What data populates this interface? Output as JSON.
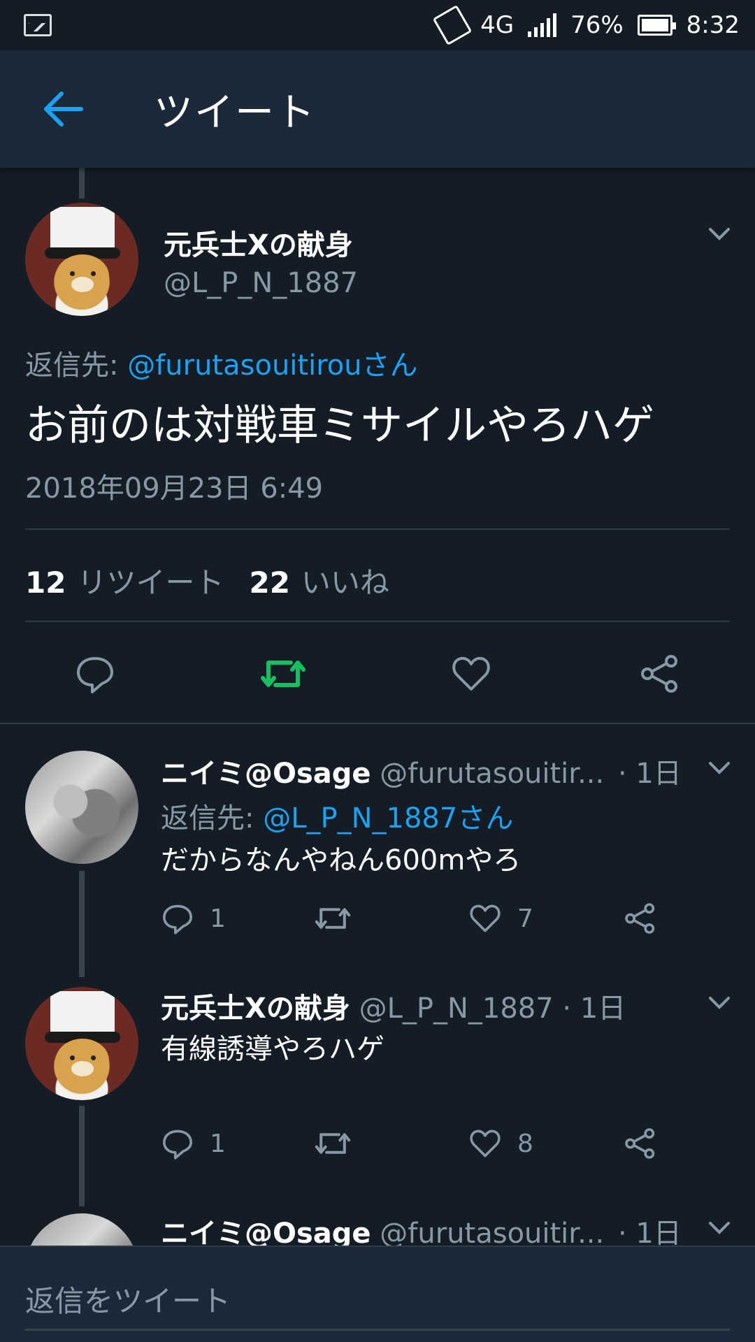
{
  "status_bar": {
    "network": "4G",
    "battery": "76%",
    "time": "8:32",
    "icons": [
      "image-icon",
      "vibrate-icon",
      "signal-icon",
      "battery-icon"
    ]
  },
  "app_bar": {
    "title": "ツイート",
    "back_icon": "arrow-left-icon"
  },
  "main_tweet": {
    "display_name": "元兵士Xの献身",
    "handle": "@L_P_N_1887",
    "reply_label": "返信先: ",
    "reply_mention": "@furutasouitirouさん",
    "text": "お前のは対戦車ミサイルやろハゲ",
    "timestamp": "2018年09月23日 6:49",
    "retweet_count": "12",
    "retweet_label": "リツイート",
    "like_count": "22",
    "like_label": "いいね"
  },
  "replies": [
    {
      "display_name": "ニイミ@Osage",
      "handle": "@furutasouitir...",
      "time": "· 1日",
      "reply_label": "返信先: ",
      "reply_mention": "@L_P_N_1887さん",
      "text": "だからなんやねん600mやろ",
      "reply_count": "1",
      "like_count": "7"
    },
    {
      "display_name": "元兵士Xの献身",
      "handle": "@L_P_N_1887",
      "time": "· 1日",
      "text": "有線誘導やろハゲ",
      "reply_count": "1",
      "like_count": "8"
    },
    {
      "display_name": "ニイミ@Osage",
      "handle": "@furutasouitir...",
      "time": "· 1日"
    }
  ],
  "composer": {
    "placeholder": "返信をツイート"
  },
  "colors": {
    "accent": "#1da1f2",
    "retweet_green": "#17bf63",
    "background": "#141d26",
    "bar": "#1c2938",
    "muted": "#8899a6"
  }
}
